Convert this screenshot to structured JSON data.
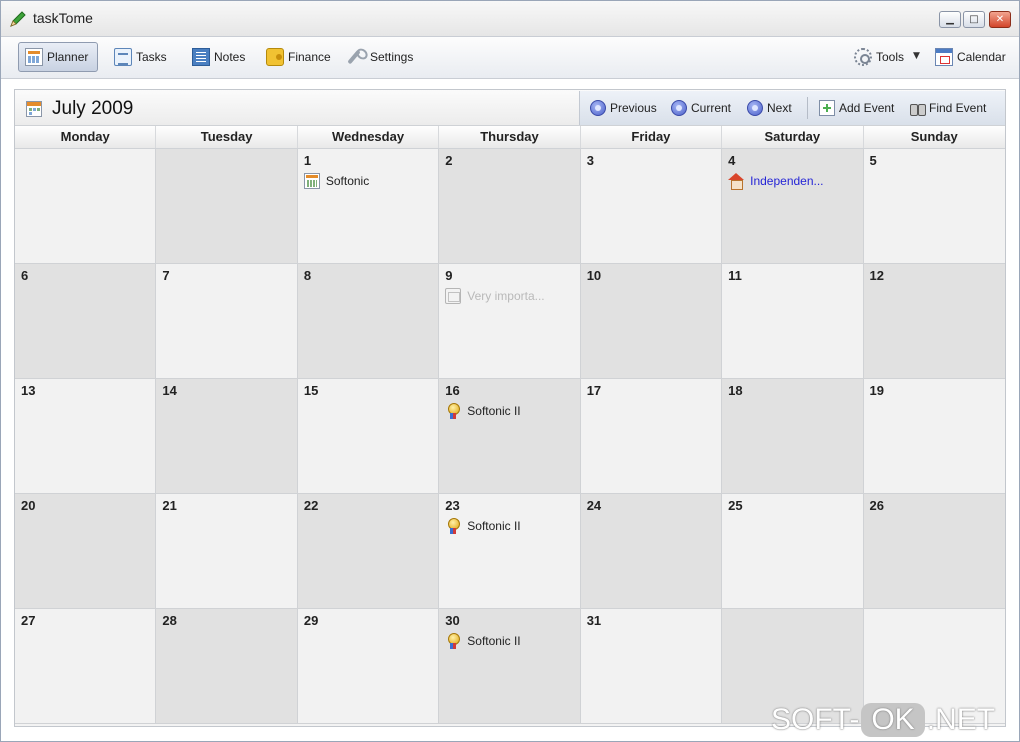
{
  "window": {
    "title": "taskTome"
  },
  "toolbar": {
    "planner": "Planner",
    "tasks": "Tasks",
    "notes": "Notes",
    "finance": "Finance",
    "settings": "Settings",
    "tools": "Tools",
    "calendar": "Calendar"
  },
  "calendar": {
    "month_title": "July 2009",
    "nav": {
      "previous": "Previous",
      "current": "Current",
      "next": "Next",
      "add_event": "Add Event",
      "find_event": "Find Event"
    },
    "days_of_week": [
      "Monday",
      "Tuesday",
      "Wednesday",
      "Thursday",
      "Friday",
      "Saturday",
      "Sunday"
    ],
    "weeks": [
      [
        {
          "day": "",
          "shade": false,
          "event": null
        },
        {
          "day": "",
          "shade": true,
          "event": null
        },
        {
          "day": "1",
          "shade": false,
          "event": {
            "text": "Softonic",
            "icon": "calendar-event-icon",
            "style": "normal"
          }
        },
        {
          "day": "2",
          "shade": true,
          "event": null
        },
        {
          "day": "3",
          "shade": false,
          "event": null
        },
        {
          "day": "4",
          "shade": true,
          "event": {
            "text": "Independen...",
            "icon": "house-icon",
            "style": "link"
          }
        },
        {
          "day": "5",
          "shade": false,
          "event": null
        }
      ],
      [
        {
          "day": "6",
          "shade": true,
          "event": null
        },
        {
          "day": "7",
          "shade": false,
          "event": null
        },
        {
          "day": "8",
          "shade": true,
          "event": null
        },
        {
          "day": "9",
          "shade": false,
          "event": {
            "text": "Very importa...",
            "icon": "folder-icon",
            "style": "faded"
          }
        },
        {
          "day": "10",
          "shade": true,
          "event": null
        },
        {
          "day": "11",
          "shade": false,
          "event": null
        },
        {
          "day": "12",
          "shade": true,
          "event": null
        }
      ],
      [
        {
          "day": "13",
          "shade": false,
          "event": null
        },
        {
          "day": "14",
          "shade": true,
          "event": null
        },
        {
          "day": "15",
          "shade": false,
          "event": null
        },
        {
          "day": "16",
          "shade": true,
          "event": {
            "text": "Softonic II",
            "icon": "medal-icon",
            "style": "normal"
          }
        },
        {
          "day": "17",
          "shade": false,
          "event": null
        },
        {
          "day": "18",
          "shade": true,
          "event": null
        },
        {
          "day": "19",
          "shade": false,
          "event": null
        }
      ],
      [
        {
          "day": "20",
          "shade": true,
          "event": null
        },
        {
          "day": "21",
          "shade": false,
          "event": null
        },
        {
          "day": "22",
          "shade": true,
          "event": null
        },
        {
          "day": "23",
          "shade": false,
          "event": {
            "text": "Softonic II",
            "icon": "medal-icon",
            "style": "normal"
          }
        },
        {
          "day": "24",
          "shade": true,
          "event": null
        },
        {
          "day": "25",
          "shade": false,
          "event": null
        },
        {
          "day": "26",
          "shade": true,
          "event": null
        }
      ],
      [
        {
          "day": "27",
          "shade": false,
          "event": null
        },
        {
          "day": "28",
          "shade": true,
          "event": null
        },
        {
          "day": "29",
          "shade": false,
          "event": null
        },
        {
          "day": "30",
          "shade": true,
          "event": {
            "text": "Softonic II",
            "icon": "medal-icon",
            "style": "normal"
          }
        },
        {
          "day": "31",
          "shade": false,
          "event": null
        },
        {
          "day": "",
          "shade": true,
          "event": null
        },
        {
          "day": "",
          "shade": false,
          "event": null
        }
      ]
    ]
  },
  "watermark": {
    "left": "SOFT-",
    "ok": "OK",
    "right": ".NET"
  },
  "colors": {
    "link": "#2424d6",
    "shade": "#e1e1e1",
    "cell": "#f2f2f2"
  }
}
